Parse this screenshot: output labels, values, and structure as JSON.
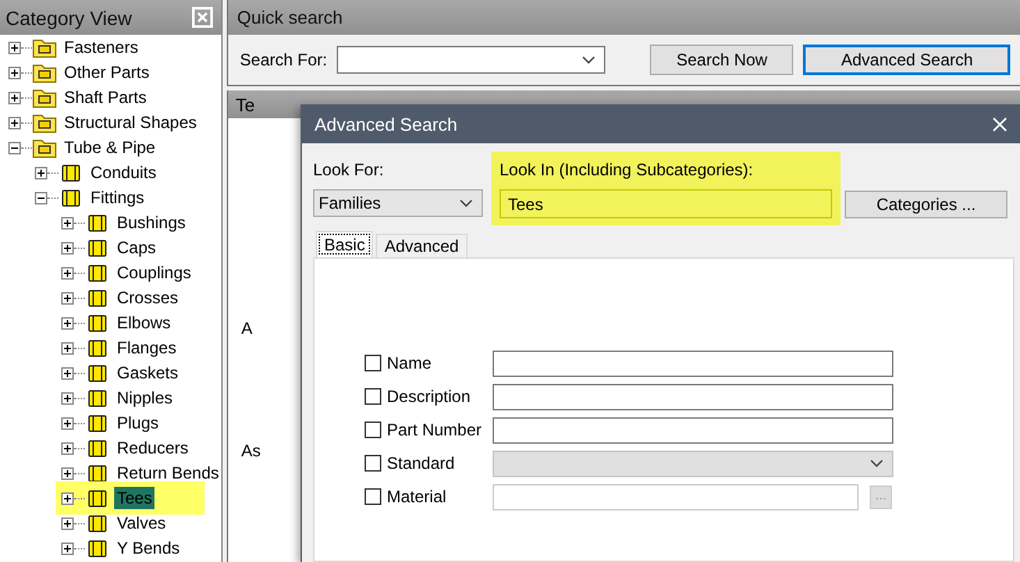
{
  "category_view": {
    "title": "Category View",
    "tree": [
      {
        "label": "Fasteners",
        "expanded": false,
        "selected": false,
        "highlighted": false
      },
      {
        "label": "Other Parts",
        "expanded": false,
        "selected": false,
        "highlighted": false
      },
      {
        "label": "Shaft Parts",
        "expanded": false,
        "selected": false,
        "highlighted": false
      },
      {
        "label": "Structural Shapes",
        "expanded": false,
        "selected": false,
        "highlighted": false
      },
      {
        "label": "Tube & Pipe",
        "expanded": true,
        "selected": false,
        "highlighted": false,
        "children": [
          {
            "label": "Conduits",
            "expanded": false,
            "selected": false,
            "highlighted": false
          },
          {
            "label": "Fittings",
            "expanded": true,
            "selected": false,
            "highlighted": false,
            "children": [
              {
                "label": "Bushings",
                "expanded": false,
                "selected": false,
                "highlighted": false
              },
              {
                "label": "Caps",
                "expanded": false,
                "selected": false,
                "highlighted": false
              },
              {
                "label": "Couplings",
                "expanded": false,
                "selected": false,
                "highlighted": false
              },
              {
                "label": "Crosses",
                "expanded": false,
                "selected": false,
                "highlighted": false
              },
              {
                "label": "Elbows",
                "expanded": false,
                "selected": false,
                "highlighted": false
              },
              {
                "label": "Flanges",
                "expanded": false,
                "selected": false,
                "highlighted": false
              },
              {
                "label": "Gaskets",
                "expanded": false,
                "selected": false,
                "highlighted": false
              },
              {
                "label": "Nipples",
                "expanded": false,
                "selected": false,
                "highlighted": false
              },
              {
                "label": "Plugs",
                "expanded": false,
                "selected": false,
                "highlighted": false
              },
              {
                "label": "Reducers",
                "expanded": false,
                "selected": false,
                "highlighted": false
              },
              {
                "label": "Return Bends",
                "expanded": false,
                "selected": false,
                "highlighted": false
              },
              {
                "label": "Tees",
                "expanded": false,
                "selected": true,
                "highlighted": true
              },
              {
                "label": "Valves",
                "expanded": false,
                "selected": false,
                "highlighted": false
              },
              {
                "label": "Y Bends",
                "expanded": false,
                "selected": false,
                "highlighted": false
              }
            ]
          }
        ]
      }
    ]
  },
  "quick_search": {
    "title": "Quick search",
    "search_label": "Search For:",
    "buttons": [
      {
        "label": "Search Now",
        "focused": false
      },
      {
        "label": "Advanced Search",
        "focused": true
      }
    ]
  },
  "background_panel": {
    "title": "Te",
    "fragments": [
      "A",
      "As"
    ]
  },
  "dialog": {
    "title": "Advanced Search",
    "look_for": {
      "label": "Look For:",
      "value": "Families"
    },
    "look_in": {
      "label": "Look In (Including Subcategories):",
      "value": "Tees",
      "highlighted": true
    },
    "categories_button": "Categories ...",
    "tabs": [
      {
        "label": "Basic",
        "selected": true
      },
      {
        "label": "Advanced",
        "selected": false
      }
    ],
    "criteria": [
      {
        "label": "Name",
        "checked": false,
        "kind": "text",
        "disabled": false
      },
      {
        "label": "Description",
        "checked": false,
        "kind": "text",
        "disabled": false
      },
      {
        "label": "Part Number",
        "checked": false,
        "kind": "text",
        "disabled": false
      },
      {
        "label": "Standard",
        "checked": false,
        "kind": "dropdown",
        "disabled": true
      },
      {
        "label": "Material",
        "checked": false,
        "kind": "browse",
        "disabled": false,
        "browse_label": "..."
      }
    ]
  }
}
